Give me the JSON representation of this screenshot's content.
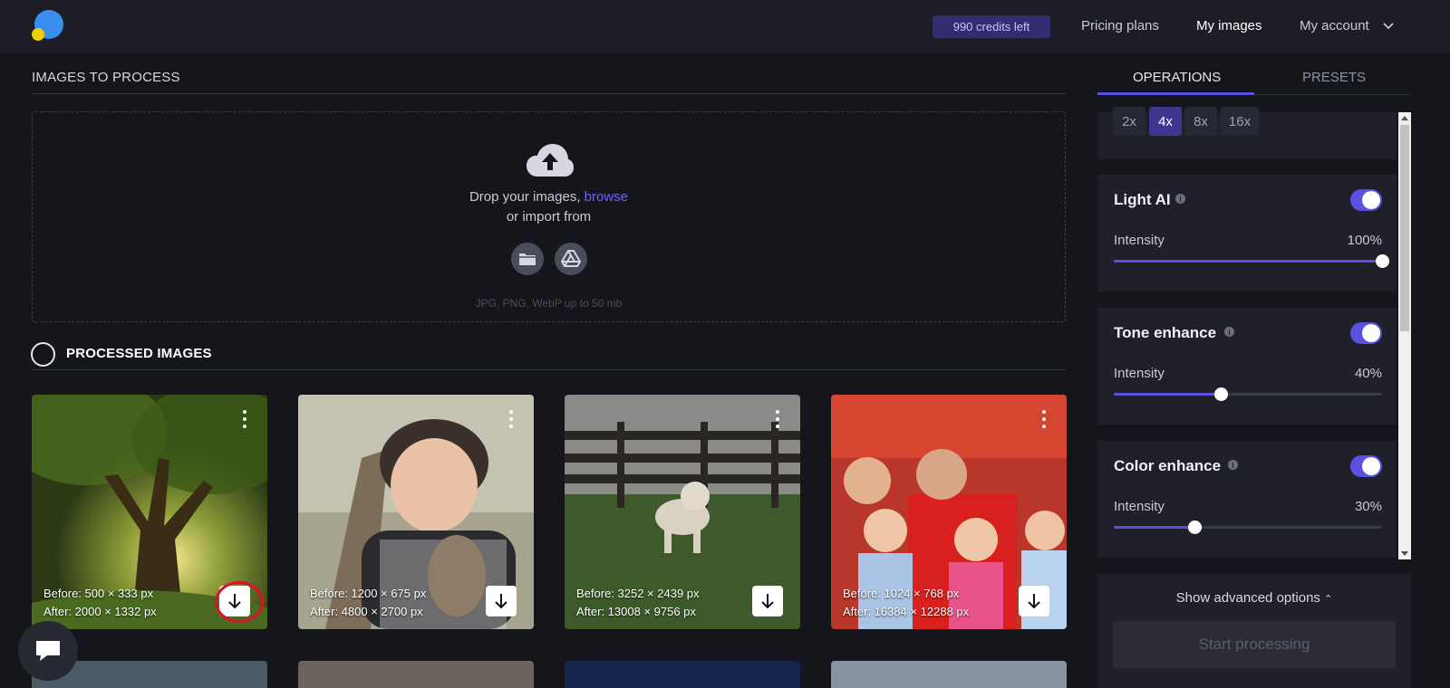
{
  "header": {
    "credits": "990 credits left",
    "nav": {
      "pricing": "Pricing plans",
      "my_images": "My images",
      "my_account": "My account"
    }
  },
  "upload": {
    "title": "IMAGES TO PROCESS",
    "drop_text": "Drop your images, ",
    "browse": "browse",
    "import_text": "or import from",
    "formats": "JPG, PNG, WebP up to 50 mb"
  },
  "processed": {
    "title": "PROCESSED IMAGES",
    "items": [
      {
        "before": "Before: 500 × 333 px",
        "after": "After: 2000 × 1332 px"
      },
      {
        "before": "Before: 1200 × 675 px",
        "after": "After: 4800 × 2700 px"
      },
      {
        "before": "Before: 3252 × 2439 px",
        "after": "After: 13008 × 9756 px"
      },
      {
        "before": "Before: 1024 × 768 px",
        "after": "After: 16384 × 12288 px"
      }
    ]
  },
  "panel": {
    "tabs": {
      "operations": "OPERATIONS",
      "presets": "PRESETS"
    },
    "scales": [
      "2x",
      "4x",
      "8x",
      "16x"
    ],
    "selected_scale": "4x",
    "operations": [
      {
        "name": "Light AI",
        "enabled": true,
        "intensity_label": "Intensity",
        "intensity": "100%",
        "level": 1.0
      },
      {
        "name": "Tone enhance",
        "enabled": true,
        "intensity_label": "Intensity",
        "intensity": "40%",
        "level": 0.4
      },
      {
        "name": "Color enhance",
        "enabled": true,
        "intensity_label": "Intensity",
        "intensity": "30%",
        "level": 0.3
      }
    ],
    "advanced": "Show advanced options",
    "start": "Start processing"
  },
  "colors": {
    "accent": "#5b50e0",
    "link": "#6f63ff",
    "credits_bg": "#322c70",
    "highlight": "#e0102a"
  }
}
